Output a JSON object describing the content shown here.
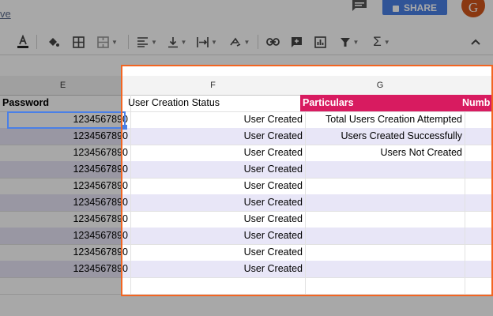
{
  "header": {
    "save_link": "ve",
    "share_label": "SHARE",
    "avatar_letter": "G"
  },
  "toolbar": {
    "icons": [
      "text-color-icon",
      "fill-color-icon",
      "borders-icon",
      "merge-cells-icon",
      "horizontal-align-icon",
      "vertical-align-icon",
      "text-wrap-icon",
      "text-rotation-icon",
      "insert-link-icon",
      "insert-comment-icon",
      "insert-chart-icon",
      "filter-icon",
      "functions-icon",
      "collapse-toolbar-icon"
    ]
  },
  "columns": {
    "e": "E",
    "f": "F",
    "g": "G"
  },
  "table": {
    "header": {
      "password": "Password",
      "status": "User Creation Status",
      "particulars": "Particulars",
      "number_partial": "Numb"
    },
    "rows": [
      {
        "password": "1234567890",
        "status": "User Created",
        "particular": "Total Users Creation Attempted"
      },
      {
        "password": "1234567890",
        "status": "User Created",
        "particular": "Users Created Successfully"
      },
      {
        "password": "1234567890",
        "status": "User Created",
        "particular": "Users Not Created"
      },
      {
        "password": "1234567890",
        "status": "User Created",
        "particular": ""
      },
      {
        "password": "1234567890",
        "status": "User Created",
        "particular": ""
      },
      {
        "password": "1234567890",
        "status": "User Created",
        "particular": ""
      },
      {
        "password": "1234567890",
        "status": "User Created",
        "particular": ""
      },
      {
        "password": "1234567890",
        "status": "User Created",
        "particular": ""
      },
      {
        "password": "1234567890",
        "status": "User Created",
        "particular": ""
      },
      {
        "password": "1234567890",
        "status": "User Created",
        "particular": ""
      }
    ]
  },
  "colors": {
    "header_accent": "#d81b60",
    "band": "#e8e6f7",
    "spotlight": "#f26522",
    "selection": "#4a80e6"
  }
}
